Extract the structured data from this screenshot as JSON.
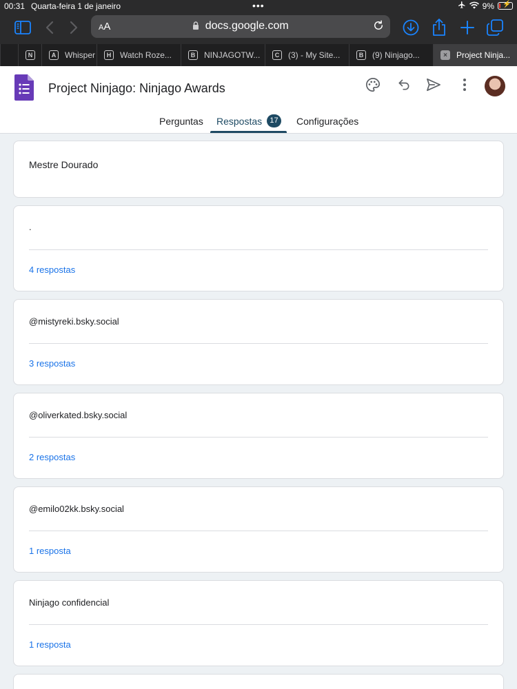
{
  "status": {
    "time": "00:31",
    "date": "Quarta-feira 1 de janeiro",
    "battery": "9%",
    "battery_level": 0.09,
    "icons": [
      "airplane-icon",
      "wifi-icon",
      "battery-charging-icon"
    ]
  },
  "browser": {
    "aa_label_small": "A",
    "aa_label_big": "A",
    "url": "docs.google.com",
    "tabs": [
      {
        "favicon": "",
        "label": ""
      },
      {
        "favicon": "N",
        "label": ""
      },
      {
        "favicon": "A",
        "label": "Whisper"
      },
      {
        "favicon": "H",
        "label": "Watch Roze..."
      },
      {
        "favicon": "B",
        "label": "NINJAGOTW..."
      },
      {
        "favicon": "C",
        "label": "(3) - My Site..."
      },
      {
        "favicon": "B",
        "label": "(9) Ninjago..."
      },
      {
        "favicon": "×",
        "label": "Project Ninja..."
      }
    ],
    "accent": "#1a84ff"
  },
  "form": {
    "title": "Project Ninjago: Ninjago Awards",
    "tabs": {
      "questions": "Perguntas",
      "responses": "Respostas",
      "responses_count": "17",
      "settings": "Configurações"
    },
    "brand_color": "#673ab7",
    "accent": "#1e4a63"
  },
  "cards": [
    {
      "question": "Mestre Dourado",
      "responses": ""
    },
    {
      "question": ".",
      "responses": "4 respostas"
    },
    {
      "question": "@mistyreki.bsky.social",
      "responses": "3 respostas"
    },
    {
      "question": "@oliverkated.bsky.social",
      "responses": "2 respostas"
    },
    {
      "question": "@emilo02kk.bsky.social",
      "responses": "1 resposta"
    },
    {
      "question": "Ninjago confidencial",
      "responses": "1 resposta"
    }
  ]
}
